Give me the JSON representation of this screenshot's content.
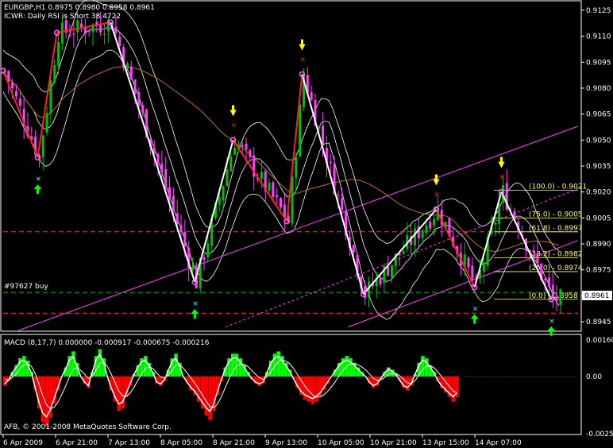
{
  "header": {
    "symbol_line": "EURGBP,H1  0.8975 0.8980 0.8958 0.8961",
    "indicator_line": "ICWR: Daily RSI is Short 38.4722"
  },
  "colors": {
    "background": "#000000",
    "grid": "#ffffff",
    "bull": "#00c000",
    "bear": "#ff40ff",
    "zigzag_red": "#ff2020",
    "zigzag_white": "#ffffff",
    "channel": "#ff40ff",
    "fib": "#ffff60",
    "ma_orange": "#c07020",
    "bollinger": "#ffffff",
    "macd_pos": "#00ff00",
    "macd_neg": "#ff0000",
    "arrow_down": "#ffff00",
    "arrow_up": "#00ff00",
    "marker_cyan": "#40ffff",
    "marker_red": "#ff2020",
    "hline_red": "#ff3030",
    "hline_green": "#00c000"
  },
  "main_chart": {
    "price_labels": [
      "0.9125",
      "0.9110",
      "0.9095",
      "0.9080",
      "0.9065",
      "0.9050",
      "0.9035",
      "0.9020",
      "0.9005",
      "0.8990",
      "0.8975",
      "0.8960",
      "0.8945"
    ],
    "current_price_label": "0.8961",
    "order_label": "#97627 buy",
    "fib_levels": [
      {
        "label": "(100.0) - 0.9021",
        "price": 0.9021
      },
      {
        "label": "(75.0) - 0.9005",
        "price": 0.9005
      },
      {
        "label": "(61.8) - 0.8997",
        "price": 0.8997
      },
      {
        "label": "(38.2) - 0.8982",
        "price": 0.8982
      },
      {
        "label": "(25.0) - 0.8974",
        "price": 0.8974
      },
      {
        "label": "(0.0) - 0.8958",
        "price": 0.8958
      }
    ]
  },
  "macd_panel": {
    "label": "MACD  (8,17,7) 0.000000 -0.000917 -0.000675 -0.000216",
    "scale_labels": [
      "0.00160",
      "0.00",
      "-0.00250"
    ],
    "copyright": "AFB, © 2001-2008 MetaQuotes Software Corp."
  },
  "time_axis": {
    "labels": [
      "6 Apr 2009",
      "6 Apr 21:00",
      "7 Apr 13:00",
      "8 Apr 05:00",
      "8 Apr 21:00",
      "9 Apr 13:00",
      "10 Apr 05:00",
      "10 Apr 21:00",
      "13 Apr 15:00",
      "14 Apr 07:00"
    ]
  },
  "chart_data": {
    "type": "candlestick",
    "symbol": "EURGBP",
    "timeframe": "H1",
    "ylim": [
      0.894,
      0.913
    ],
    "zigzag_points": [
      {
        "bar": 0,
        "price": 0.909
      },
      {
        "bar": 9,
        "price": 0.904
      },
      {
        "bar": 14,
        "price": 0.9112
      },
      {
        "bar": 28,
        "price": 0.9118
      },
      {
        "bar": 50,
        "price": 0.8968
      },
      {
        "bar": 60,
        "price": 0.905
      },
      {
        "bar": 74,
        "price": 0.9003
      },
      {
        "bar": 78,
        "price": 0.9088
      },
      {
        "bar": 94,
        "price": 0.8961
      },
      {
        "bar": 113,
        "price": 0.901
      },
      {
        "bar": 123,
        "price": 0.8965
      },
      {
        "bar": 130,
        "price": 0.902
      },
      {
        "bar": 143,
        "price": 0.8958
      }
    ],
    "macd_range": [
      -0.0025,
      0.0016
    ],
    "macd_hist": [
      -0.0004,
      -0.0002,
      0.0002,
      0.0005,
      0.0008,
      0.0009,
      0.0007,
      0.0002,
      -0.0006,
      -0.0014,
      -0.002,
      -0.0022,
      -0.0018,
      -0.0012,
      -0.0006,
      0.0,
      0.0004,
      0.0009,
      0.0011,
      0.0006,
      0.0,
      -0.0003,
      -0.0005,
      0.0002,
      0.0009,
      0.0012,
      0.0008,
      0.0,
      -0.0006,
      -0.0011,
      -0.0015,
      -0.0014,
      -0.0009,
      -0.0004,
      0.0001,
      0.0005,
      0.0008,
      0.0009,
      0.0006,
      0.0002,
      -0.0003,
      -0.0004,
      -0.0002,
      0.0003,
      0.0008,
      0.001,
      0.0006,
      0.0,
      -0.0003,
      -0.0006,
      -0.0008,
      -0.0011,
      -0.0014,
      -0.0017,
      -0.0019,
      -0.0015,
      -0.0008,
      -0.0002,
      0.0004,
      0.0008,
      0.001,
      0.001,
      0.0008,
      0.0005,
      0.0002,
      -0.0001,
      -0.0003,
      -0.0004,
      -0.0003,
      0.0002,
      0.0007,
      0.001,
      0.0011,
      0.0009,
      0.0006,
      0.0003,
      -0.0001,
      -0.0005,
      -0.0008,
      -0.001,
      -0.0011,
      -0.0012,
      -0.0011,
      -0.0009,
      -0.0006,
      -0.0003,
      0.0,
      0.0003,
      0.0006,
      0.0008,
      0.0009,
      0.0008,
      0.0006,
      0.0004,
      0.0002,
      0.0,
      -0.0003,
      -0.0005,
      -0.0004,
      -0.0001,
      0.0002,
      0.0004,
      0.0003,
      0.0001,
      -0.0002,
      -0.0005,
      -0.0006,
      -0.0004,
      0.0001,
      0.0006,
      0.0009,
      0.0008,
      0.0005,
      0.0002,
      -0.0002,
      -0.0005,
      -0.0007,
      -0.0009,
      -0.0011,
      -0.0009
    ]
  }
}
